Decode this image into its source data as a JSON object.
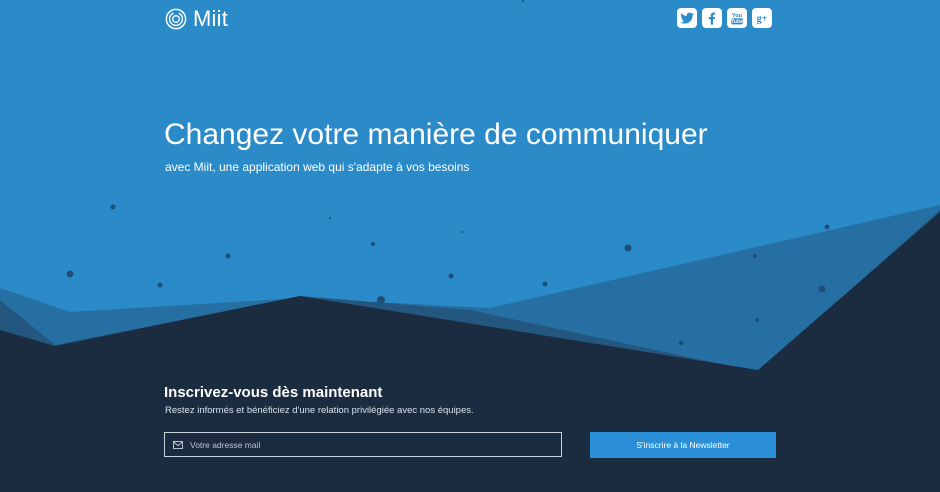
{
  "brand": {
    "name": "Miit",
    "logo_icon": "concentric-circles-logo-icon"
  },
  "social": [
    {
      "name": "twitter",
      "icon": "twitter-icon"
    },
    {
      "name": "facebook",
      "icon": "facebook-icon"
    },
    {
      "name": "youtube",
      "icon": "youtube-icon",
      "label_top": "You",
      "label_bottom": "Tube"
    },
    {
      "name": "google-plus",
      "icon": "google-plus-icon",
      "label": "g+"
    }
  ],
  "hero": {
    "title": "Changez votre manière de communiquer",
    "subtitle": "avec Miit, une application web qui s'adapte à vos besoins"
  },
  "signup": {
    "title": "Inscrivez-vous dès maintenant",
    "description": "Restez informés et bénéficiez d'une relation privilégiée avec nos équipes.",
    "email_value": "",
    "email_placeholder": "Votre adresse mail",
    "email_icon": "envelope-icon",
    "button_label": "S'inscrire à la Newsletter"
  },
  "colors": {
    "sky": "#2b8ac8",
    "mountain_light": "#266fa3",
    "mountain_mid": "#23577f",
    "ground": "#1c2c40",
    "button": "#2b8fd8",
    "text": "#ffffff"
  }
}
